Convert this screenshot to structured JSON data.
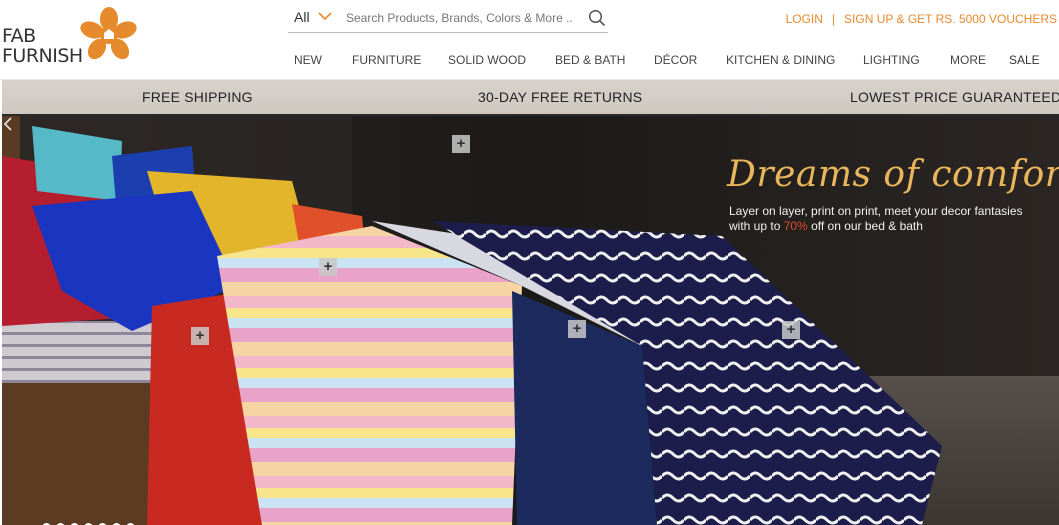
{
  "header": {
    "logo": {
      "line1": "FAB",
      "line2": "FURNISH"
    },
    "search": {
      "scope": "All",
      "placeholder": "Search Products, Brands, Colors & More ..",
      "icon": "search-icon"
    },
    "account": {
      "login": "LOGIN",
      "separator": "|",
      "signup": "SIGN UP & GET RS. 5000 VOUCHERS"
    },
    "nav": [
      {
        "label": "NEW"
      },
      {
        "label": "FURNITURE"
      },
      {
        "label": "SOLID WOOD"
      },
      {
        "label": "BED & BATH"
      },
      {
        "label": "DÉCOR"
      },
      {
        "label": "KITCHEN & DINING"
      },
      {
        "label": "LIGHTING"
      },
      {
        "label": "MORE"
      },
      {
        "label": "SALE"
      }
    ]
  },
  "promo": [
    "FREE SHIPPING",
    "30-DAY FREE RETURNS",
    "LOWEST PRICE GUARANTEED"
  ],
  "hero": {
    "title": "Dreams of comfort",
    "subtitle_part1": "Layer on layer, print on print, meet your decor fantasies with up to ",
    "subtitle_pct": "70%",
    "subtitle_part2": " off on our bed & bath",
    "hotspot_symbol": "+",
    "slide_count": 7
  },
  "colors": {
    "accent": "#e68a2e",
    "title_gold": "#e9b65c",
    "highlight_red": "#e04b2f"
  }
}
